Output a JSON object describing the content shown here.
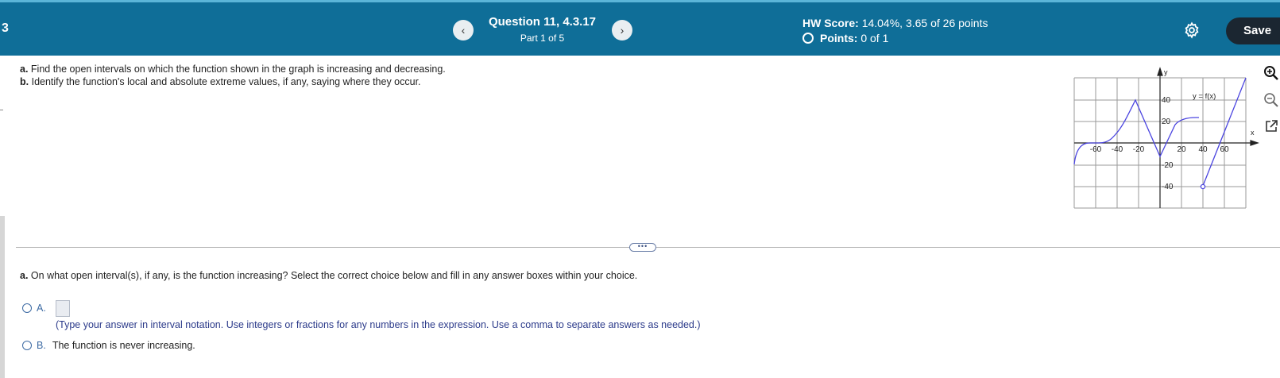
{
  "header": {
    "question_number_fragment": "3",
    "prev_glyph": "‹",
    "next_glyph": "›",
    "question_title": "Question 11, 4.3.17",
    "part_label": "Part 1 of 5",
    "hw_score_label": "HW Score:",
    "hw_score_value": "14.04%, 3.65 of 26 points",
    "points_label": "Points:",
    "points_value": "0 of 1",
    "save_label": "Save"
  },
  "problem": {
    "a_prefix": "a.",
    "a_text": "Find the open intervals on which the function shown in the graph is increasing and decreasing.",
    "b_prefix": "b.",
    "b_text": "Identify the function's local and absolute extreme values, if any, saying where they occur."
  },
  "graph": {
    "y_axis_label": "y",
    "x_axis_label": "x",
    "function_label": "y = f(x)",
    "x_tick_labels": [
      "-60",
      "-40",
      "-20",
      "20",
      "40",
      "60"
    ],
    "y_tick_labels": [
      "40",
      "20",
      "-20",
      "-40"
    ],
    "curve_color": "#4b45e0"
  },
  "expander_label": "•••",
  "question_a": {
    "prefix": "a.",
    "text": "On what open interval(s), if any, is the function increasing? Select the correct choice below and fill in any answer boxes within your choice."
  },
  "choices": {
    "a_label": "A.",
    "a_hint": "(Type your answer in interval notation. Use integers or fractions for any numbers in the expression. Use a comma to separate answers as needed.)",
    "b_label": "B.",
    "b_text": "The function is never increasing."
  },
  "icons": [
    "chevron-left-icon",
    "chevron-right-icon",
    "gear-icon",
    "zoom-in-icon",
    "zoom-out-icon",
    "open-external-icon"
  ]
}
